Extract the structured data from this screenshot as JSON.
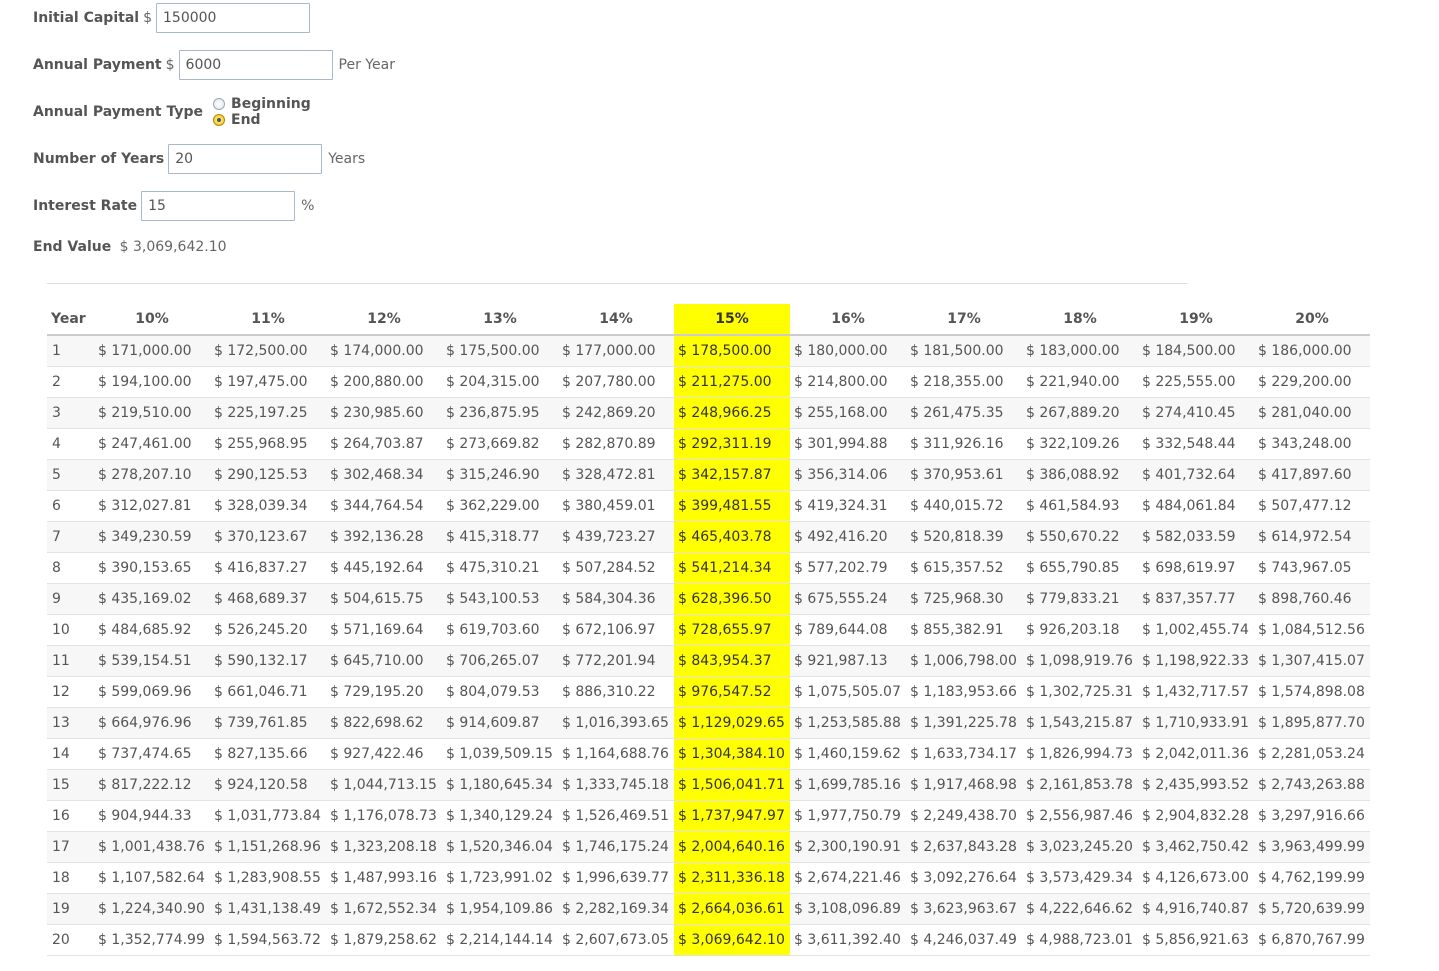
{
  "form": {
    "initial_capital": {
      "label": "Initial Capital",
      "currency": "$",
      "value": "150000"
    },
    "annual_payment": {
      "label": "Annual Payment",
      "currency": "$",
      "value": "6000",
      "suffix": "Per Year"
    },
    "payment_type": {
      "label": "Annual Payment Type",
      "options": [
        "Beginning",
        "End"
      ],
      "selected": "End"
    },
    "years": {
      "label": "Number of Years",
      "value": "20",
      "suffix": "Years"
    },
    "interest": {
      "label": "Interest Rate",
      "value": "15",
      "suffix": "%"
    },
    "end_value": {
      "label": "End Value",
      "value": "$ 3,069,642.10"
    }
  },
  "table": {
    "year_header": "Year",
    "highlight_rate": "15%",
    "rates": [
      "10%",
      "11%",
      "12%",
      "13%",
      "14%",
      "15%",
      "16%",
      "17%",
      "18%",
      "19%",
      "20%"
    ],
    "rows": [
      {
        "year": "1",
        "values": [
          "$ 171,000.00",
          "$ 172,500.00",
          "$ 174,000.00",
          "$ 175,500.00",
          "$ 177,000.00",
          "$ 178,500.00",
          "$ 180,000.00",
          "$ 181,500.00",
          "$ 183,000.00",
          "$ 184,500.00",
          "$ 186,000.00"
        ]
      },
      {
        "year": "2",
        "values": [
          "$ 194,100.00",
          "$ 197,475.00",
          "$ 200,880.00",
          "$ 204,315.00",
          "$ 207,780.00",
          "$ 211,275.00",
          "$ 214,800.00",
          "$ 218,355.00",
          "$ 221,940.00",
          "$ 225,555.00",
          "$ 229,200.00"
        ]
      },
      {
        "year": "3",
        "values": [
          "$ 219,510.00",
          "$ 225,197.25",
          "$ 230,985.60",
          "$ 236,875.95",
          "$ 242,869.20",
          "$ 248,966.25",
          "$ 255,168.00",
          "$ 261,475.35",
          "$ 267,889.20",
          "$ 274,410.45",
          "$ 281,040.00"
        ]
      },
      {
        "year": "4",
        "values": [
          "$ 247,461.00",
          "$ 255,968.95",
          "$ 264,703.87",
          "$ 273,669.82",
          "$ 282,870.89",
          "$ 292,311.19",
          "$ 301,994.88",
          "$ 311,926.16",
          "$ 322,109.26",
          "$ 332,548.44",
          "$ 343,248.00"
        ]
      },
      {
        "year": "5",
        "values": [
          "$ 278,207.10",
          "$ 290,125.53",
          "$ 302,468.34",
          "$ 315,246.90",
          "$ 328,472.81",
          "$ 342,157.87",
          "$ 356,314.06",
          "$ 370,953.61",
          "$ 386,088.92",
          "$ 401,732.64",
          "$ 417,897.60"
        ]
      },
      {
        "year": "6",
        "values": [
          "$ 312,027.81",
          "$ 328,039.34",
          "$ 344,764.54",
          "$ 362,229.00",
          "$ 380,459.01",
          "$ 399,481.55",
          "$ 419,324.31",
          "$ 440,015.72",
          "$ 461,584.93",
          "$ 484,061.84",
          "$ 507,477.12"
        ]
      },
      {
        "year": "7",
        "values": [
          "$ 349,230.59",
          "$ 370,123.67",
          "$ 392,136.28",
          "$ 415,318.77",
          "$ 439,723.27",
          "$ 465,403.78",
          "$ 492,416.20",
          "$ 520,818.39",
          "$ 550,670.22",
          "$ 582,033.59",
          "$ 614,972.54"
        ]
      },
      {
        "year": "8",
        "values": [
          "$ 390,153.65",
          "$ 416,837.27",
          "$ 445,192.64",
          "$ 475,310.21",
          "$ 507,284.52",
          "$ 541,214.34",
          "$ 577,202.79",
          "$ 615,357.52",
          "$ 655,790.85",
          "$ 698,619.97",
          "$ 743,967.05"
        ]
      },
      {
        "year": "9",
        "values": [
          "$ 435,169.02",
          "$ 468,689.37",
          "$ 504,615.75",
          "$ 543,100.53",
          "$ 584,304.36",
          "$ 628,396.50",
          "$ 675,555.24",
          "$ 725,968.30",
          "$ 779,833.21",
          "$ 837,357.77",
          "$ 898,760.46"
        ]
      },
      {
        "year": "10",
        "values": [
          "$ 484,685.92",
          "$ 526,245.20",
          "$ 571,169.64",
          "$ 619,703.60",
          "$ 672,106.97",
          "$ 728,655.97",
          "$ 789,644.08",
          "$ 855,382.91",
          "$ 926,203.18",
          "$ 1,002,455.74",
          "$ 1,084,512.56"
        ]
      },
      {
        "year": "11",
        "values": [
          "$ 539,154.51",
          "$ 590,132.17",
          "$ 645,710.00",
          "$ 706,265.07",
          "$ 772,201.94",
          "$ 843,954.37",
          "$ 921,987.13",
          "$ 1,006,798.00",
          "$ 1,098,919.76",
          "$ 1,198,922.33",
          "$ 1,307,415.07"
        ]
      },
      {
        "year": "12",
        "values": [
          "$ 599,069.96",
          "$ 661,046.71",
          "$ 729,195.20",
          "$ 804,079.53",
          "$ 886,310.22",
          "$ 976,547.52",
          "$ 1,075,505.07",
          "$ 1,183,953.66",
          "$ 1,302,725.31",
          "$ 1,432,717.57",
          "$ 1,574,898.08"
        ]
      },
      {
        "year": "13",
        "values": [
          "$ 664,976.96",
          "$ 739,761.85",
          "$ 822,698.62",
          "$ 914,609.87",
          "$ 1,016,393.65",
          "$ 1,129,029.65",
          "$ 1,253,585.88",
          "$ 1,391,225.78",
          "$ 1,543,215.87",
          "$ 1,710,933.91",
          "$ 1,895,877.70"
        ]
      },
      {
        "year": "14",
        "values": [
          "$ 737,474.65",
          "$ 827,135.66",
          "$ 927,422.46",
          "$ 1,039,509.15",
          "$ 1,164,688.76",
          "$ 1,304,384.10",
          "$ 1,460,159.62",
          "$ 1,633,734.17",
          "$ 1,826,994.73",
          "$ 2,042,011.36",
          "$ 2,281,053.24"
        ]
      },
      {
        "year": "15",
        "values": [
          "$ 817,222.12",
          "$ 924,120.58",
          "$ 1,044,713.15",
          "$ 1,180,645.34",
          "$ 1,333,745.18",
          "$ 1,506,041.71",
          "$ 1,699,785.16",
          "$ 1,917,468.98",
          "$ 2,161,853.78",
          "$ 2,435,993.52",
          "$ 2,743,263.88"
        ]
      },
      {
        "year": "16",
        "values": [
          "$ 904,944.33",
          "$ 1,031,773.84",
          "$ 1,176,078.73",
          "$ 1,340,129.24",
          "$ 1,526,469.51",
          "$ 1,737,947.97",
          "$ 1,977,750.79",
          "$ 2,249,438.70",
          "$ 2,556,987.46",
          "$ 2,904,832.28",
          "$ 3,297,916.66"
        ]
      },
      {
        "year": "17",
        "values": [
          "$ 1,001,438.76",
          "$ 1,151,268.96",
          "$ 1,323,208.18",
          "$ 1,520,346.04",
          "$ 1,746,175.24",
          "$ 2,004,640.16",
          "$ 2,300,190.91",
          "$ 2,637,843.28",
          "$ 3,023,245.20",
          "$ 3,462,750.42",
          "$ 3,963,499.99"
        ]
      },
      {
        "year": "18",
        "values": [
          "$ 1,107,582.64",
          "$ 1,283,908.55",
          "$ 1,487,993.16",
          "$ 1,723,991.02",
          "$ 1,996,639.77",
          "$ 2,311,336.18",
          "$ 2,674,221.46",
          "$ 3,092,276.64",
          "$ 3,573,429.34",
          "$ 4,126,673.00",
          "$ 4,762,199.99"
        ]
      },
      {
        "year": "19",
        "values": [
          "$ 1,224,340.90",
          "$ 1,431,138.49",
          "$ 1,672,552.34",
          "$ 1,954,109.86",
          "$ 2,282,169.34",
          "$ 2,664,036.61",
          "$ 3,108,096.89",
          "$ 3,623,963.67",
          "$ 4,222,646.62",
          "$ 4,916,740.87",
          "$ 5,720,639.99"
        ]
      },
      {
        "year": "20",
        "values": [
          "$ 1,352,774.99",
          "$ 1,594,563.72",
          "$ 1,879,258.62",
          "$ 2,214,144.14",
          "$ 2,607,673.05",
          "$ 3,069,642.10",
          "$ 3,611,392.40",
          "$ 4,246,037.49",
          "$ 4,988,723.01",
          "$ 5,856,921.63",
          "$ 6,870,767.99"
        ]
      }
    ]
  },
  "colors": {
    "highlight": "#ffff00"
  }
}
